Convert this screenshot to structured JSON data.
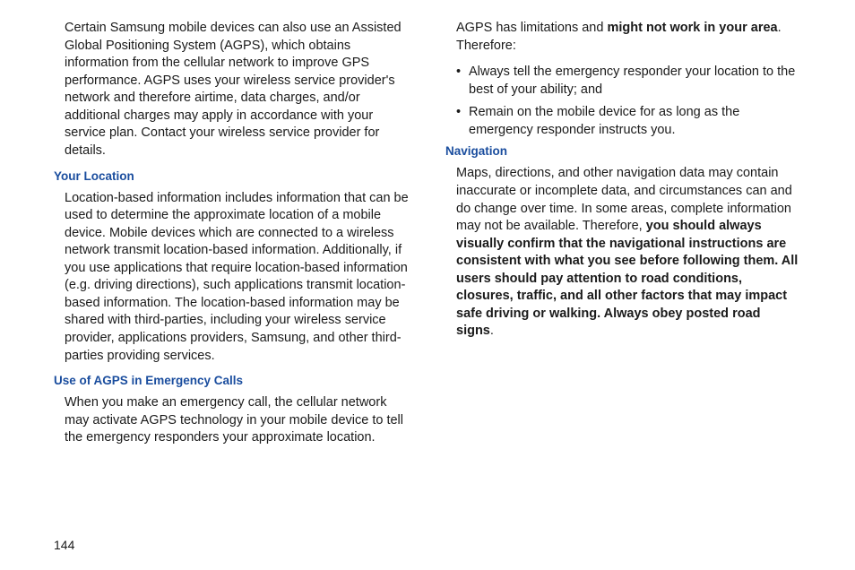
{
  "page_number": "144",
  "left_column": {
    "para1": "Certain Samsung mobile devices can also use an Assisted Global Positioning System (AGPS), which obtains information from the cellular network to improve GPS performance. AGPS uses your wireless service provider's network and therefore airtime, data charges, and/or additional charges may apply in accordance with your service plan. Contact your wireless service provider for details.",
    "heading1": "Your Location",
    "para2": "Location-based information includes information that can be used to determine the approximate location of a mobile device. Mobile devices which are connected to a wireless network transmit location-based information. Additionally, if you use applications that require location-based information (e.g. driving directions), such applications transmit location-based information. The location-based information may be shared with third-parties, including your wireless service provider, applications providers, Samsung, and other third-parties providing services.",
    "heading2": "Use of AGPS in Emergency Calls",
    "para3": "When you make an emergency call, the cellular network may activate AGPS technology in your mobile device to tell the emergency responders your approximate location."
  },
  "right_column": {
    "para1_pre": "AGPS has limitations and ",
    "para1_bold": "might not work in your area",
    "para1_post": ". Therefore:",
    "bullet1": "Always tell the emergency responder your location to the best of your ability; and",
    "bullet2": "Remain on the mobile device for as long as the emergency responder instructs you.",
    "heading1": "Navigation",
    "para2_pre": "Maps, directions, and other navigation data may contain inaccurate or incomplete data, and circumstances can and do change over time. In some areas, complete information may not be available. Therefore, ",
    "para2_bold": "you should always visually confirm that the navigational instructions are consistent with what you see before following them. All users should pay attention to road conditions, closures, traffic, and all other factors that may impact safe driving or walking. Always obey posted road signs",
    "para2_post": "."
  }
}
